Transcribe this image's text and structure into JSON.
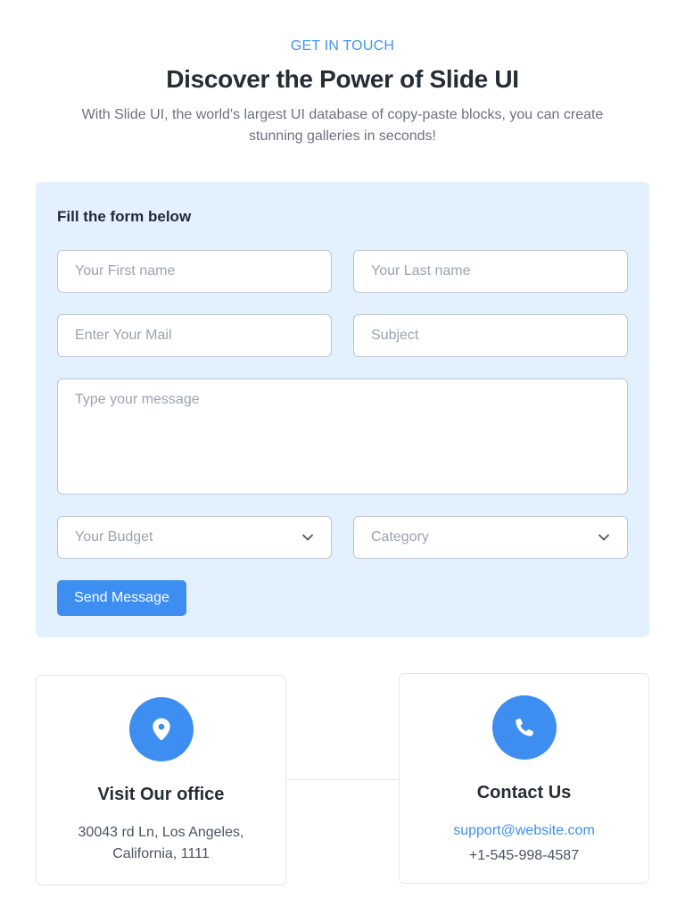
{
  "header": {
    "eyebrow": "GET IN TOUCH",
    "title": "Discover the Power of Slide UI",
    "description": "With Slide UI, the world's largest UI database of copy-paste blocks, you can create stunning galleries in seconds!"
  },
  "form": {
    "heading": "Fill the form below",
    "first_name_placeholder": "Your First name",
    "last_name_placeholder": "Your Last name",
    "email_placeholder": "Enter Your Mail",
    "subject_placeholder": "Subject",
    "message_placeholder": "Type your message",
    "budget_selected": "Your Budget",
    "category_selected": "Category",
    "submit_label": "Send Message"
  },
  "office": {
    "icon": "map-pin-icon",
    "title": "Visit Our office",
    "address_line1": "30043 rd Ln, Los Angeles,",
    "address_line2": "California, 1111"
  },
  "contact": {
    "icon": "phone-icon",
    "title": "Contact Us",
    "email": "support@website.com",
    "phone": "+1-545-998-4587"
  },
  "colors": {
    "accent": "#3d8ef0",
    "form_background": "#e3f0fd",
    "heading_text": "#262d36",
    "muted_text": "#6b7280"
  }
}
